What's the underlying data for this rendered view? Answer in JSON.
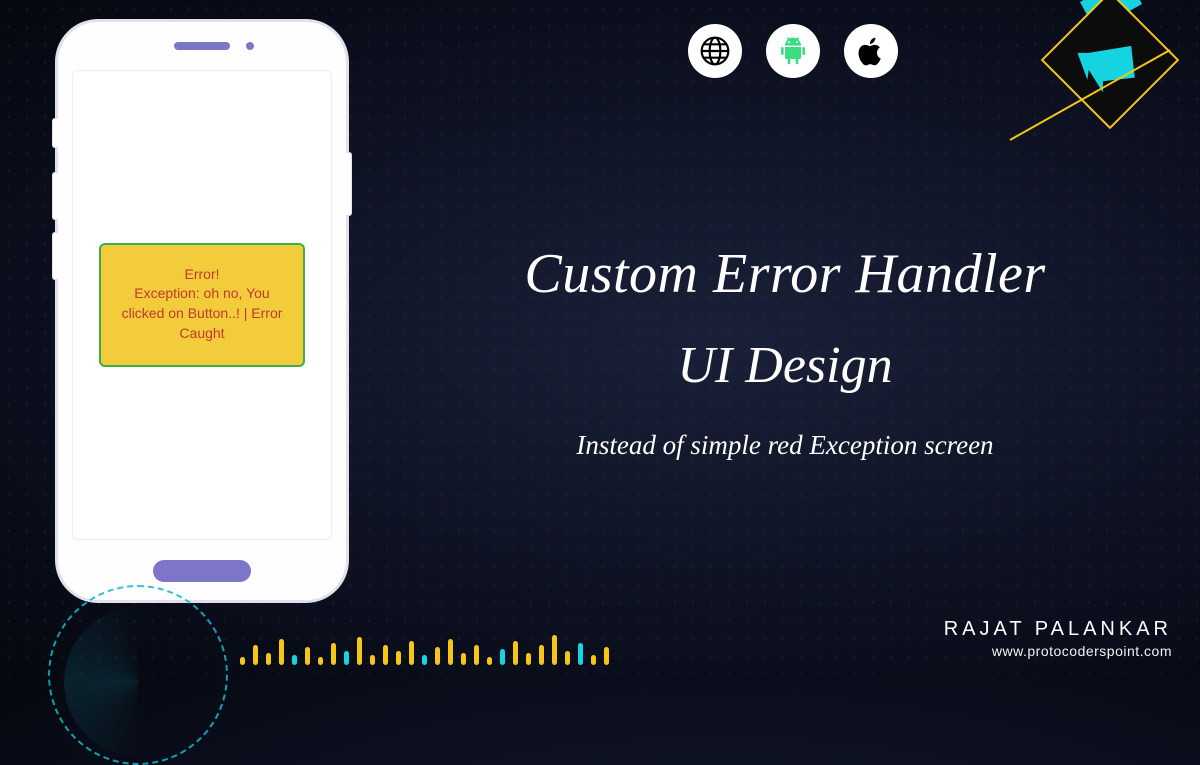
{
  "error_card": {
    "title": "Error!",
    "line1": "Exception: oh no, You",
    "line2": "clicked on Button..! | Error",
    "line3": "Caught"
  },
  "platform_icons": [
    "web",
    "android",
    "apple"
  ],
  "headline": {
    "line1": "Custom Error Handler",
    "line2": "UI Design"
  },
  "subtitle": "Instead of simple red Exception screen",
  "author": {
    "name": "RAJAT PALANKAR",
    "url": "www.protocoderspoint.com"
  },
  "colors": {
    "card_bg": "#f3cc3c",
    "card_border": "#3fae49",
    "card_text": "#c0392b",
    "accent_cyan": "#15d4e0",
    "accent_yellow": "#f5c518",
    "phone_accent": "#7d75c8"
  }
}
